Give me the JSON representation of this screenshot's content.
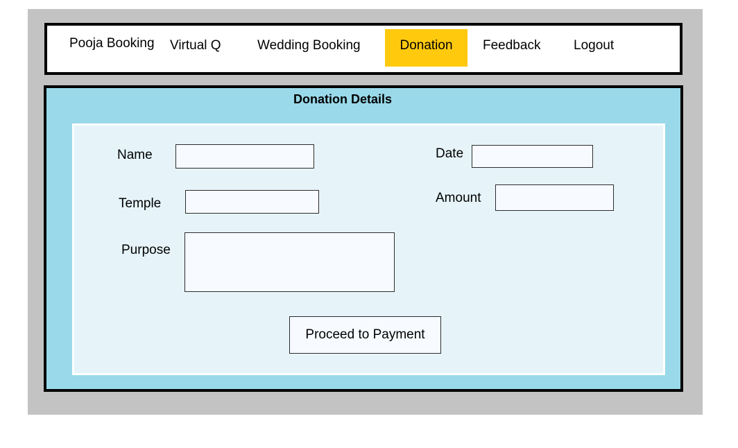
{
  "nav": {
    "items": [
      {
        "label": "Pooja Booking"
      },
      {
        "label": "Virtual Q"
      },
      {
        "label": "Wedding Booking"
      },
      {
        "label": "Donation"
      },
      {
        "label": "Feedback"
      },
      {
        "label": "Logout"
      }
    ],
    "active_color": "#ffc90e"
  },
  "panel": {
    "title": "Donation Details",
    "background": "#99d9ea"
  },
  "form": {
    "name": {
      "label": "Name",
      "value": ""
    },
    "temple": {
      "label": "Temple",
      "value": ""
    },
    "purpose": {
      "label": "Purpose",
      "value": ""
    },
    "date": {
      "label": "Date",
      "value": ""
    },
    "amount": {
      "label": "Amount",
      "value": ""
    },
    "submit_label": "Proceed to Payment"
  }
}
